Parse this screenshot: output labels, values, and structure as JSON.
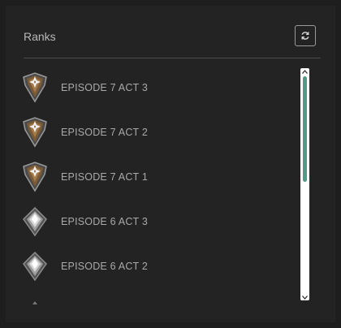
{
  "panel": {
    "title": "Ranks",
    "refresh_icon": "refresh-icon"
  },
  "ranks": [
    {
      "label": "EPISODE 7 ACT 3",
      "icon": "bronze-rank-icon"
    },
    {
      "label": "EPISODE 7 ACT 2",
      "icon": "bronze-rank-icon"
    },
    {
      "label": "EPISODE 7 ACT 1",
      "icon": "bronze-rank-icon"
    },
    {
      "label": "EPISODE 6 ACT 3",
      "icon": "silver-rank-icon"
    },
    {
      "label": "EPISODE 6 ACT 2",
      "icon": "silver-rank-icon"
    }
  ],
  "scroll": {
    "position": 0.0
  },
  "colors": {
    "background": "#1e1e1e",
    "panel": "#232323",
    "text": "#a9a9a9",
    "scroll_thumb": "#4f9b85",
    "bronze": "#8a6a45",
    "silver": "#c9c9c9"
  }
}
